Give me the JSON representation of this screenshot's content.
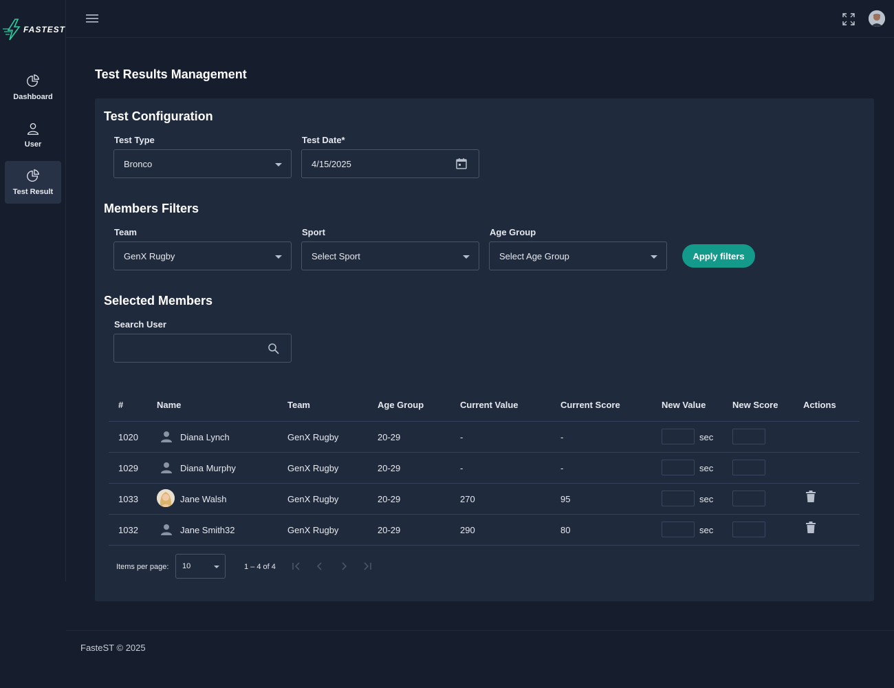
{
  "app": {
    "logo_text": "FASTEST"
  },
  "sidebar": {
    "items": [
      {
        "label": "Dashboard",
        "icon": "pie-chart-icon",
        "active": false
      },
      {
        "label": "User",
        "icon": "user-icon",
        "active": false
      },
      {
        "label": "Test Result",
        "icon": "pie-chart-icon",
        "active": true
      }
    ]
  },
  "topbar": {
    "menu_icon": "hamburger-icon",
    "fullscreen_icon": "fullscreen-icon",
    "avatar": "user-avatar"
  },
  "page": {
    "title": "Test Results Management"
  },
  "config": {
    "title": "Test Configuration",
    "test_type_label": "Test Type",
    "test_type_value": "Bronco",
    "test_date_label": "Test Date*",
    "test_date_value": "4/15/2025"
  },
  "filters": {
    "title": "Members Filters",
    "team_label": "Team",
    "team_value": "GenX Rugby",
    "sport_label": "Sport",
    "sport_value": "Select Sport",
    "age_label": "Age Group",
    "age_value": "Select Age Group",
    "apply_label": "Apply filters"
  },
  "members": {
    "title": "Selected Members",
    "search_label": "Search User",
    "search_value": ""
  },
  "table": {
    "headers": [
      "#",
      "Name",
      "Team",
      "Age Group",
      "Current Value",
      "Current Score",
      "New Value",
      "New Score",
      "Actions"
    ],
    "unit": "sec",
    "rows": [
      {
        "id": "1020",
        "name": "Diana Lynch",
        "team": "GenX Rugby",
        "age_group": "20-29",
        "current_value": "-",
        "current_score": "-",
        "avatar": "person-icon",
        "deletable": false
      },
      {
        "id": "1029",
        "name": "Diana Murphy",
        "team": "GenX Rugby",
        "age_group": "20-29",
        "current_value": "-",
        "current_score": "-",
        "avatar": "person-icon",
        "deletable": false
      },
      {
        "id": "1033",
        "name": "Jane Walsh",
        "team": "GenX Rugby",
        "age_group": "20-29",
        "current_value": "270",
        "current_score": "95",
        "avatar": "photo",
        "deletable": true
      },
      {
        "id": "1032",
        "name": "Jane Smith32",
        "team": "GenX Rugby",
        "age_group": "20-29",
        "current_value": "290",
        "current_score": "80",
        "avatar": "person-icon",
        "deletable": true
      }
    ]
  },
  "paginator": {
    "items_per_page_label": "Items per page:",
    "page_size": "10",
    "range": "1 – 4 of 4"
  },
  "footer": {
    "text": "FasteST © 2025"
  },
  "colors": {
    "background": "#161d2d",
    "card": "#1f2a3c",
    "accent": "#149a8a"
  }
}
